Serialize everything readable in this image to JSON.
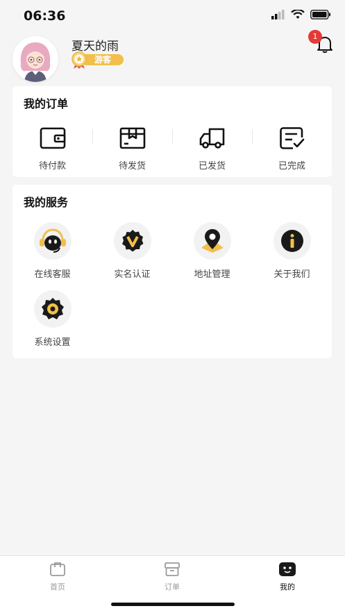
{
  "status_bar": {
    "time": "06:36"
  },
  "profile": {
    "username": "夏天的雨",
    "badge": "游客",
    "notification_count": "1"
  },
  "orders": {
    "title": "我的订单",
    "items": [
      {
        "label": "待付款",
        "icon": "wallet-icon"
      },
      {
        "label": "待发货",
        "icon": "package-icon"
      },
      {
        "label": "已发货",
        "icon": "truck-icon"
      },
      {
        "label": "已完成",
        "icon": "completed-list-icon"
      }
    ]
  },
  "services": {
    "title": "我的服务",
    "items": [
      {
        "label": "在线客服",
        "icon": "customer-service-icon"
      },
      {
        "label": "实名认证",
        "icon": "verified-v-icon"
      },
      {
        "label": "地址管理",
        "icon": "location-pin-icon"
      },
      {
        "label": "关于我们",
        "icon": "info-icon"
      },
      {
        "label": "系统设置",
        "icon": "gear-icon"
      }
    ]
  },
  "tabbar": {
    "items": [
      {
        "label": "首页",
        "icon": "home-icon"
      },
      {
        "label": "订单",
        "icon": "order-box-icon"
      },
      {
        "label": "我的",
        "icon": "profile-face-icon",
        "active": true
      }
    ]
  },
  "colors": {
    "accent_yellow": "#f1bf4a",
    "badge_red": "#e53935",
    "icon_dark": "#1a1a1a",
    "background": "#f5f5f5"
  }
}
